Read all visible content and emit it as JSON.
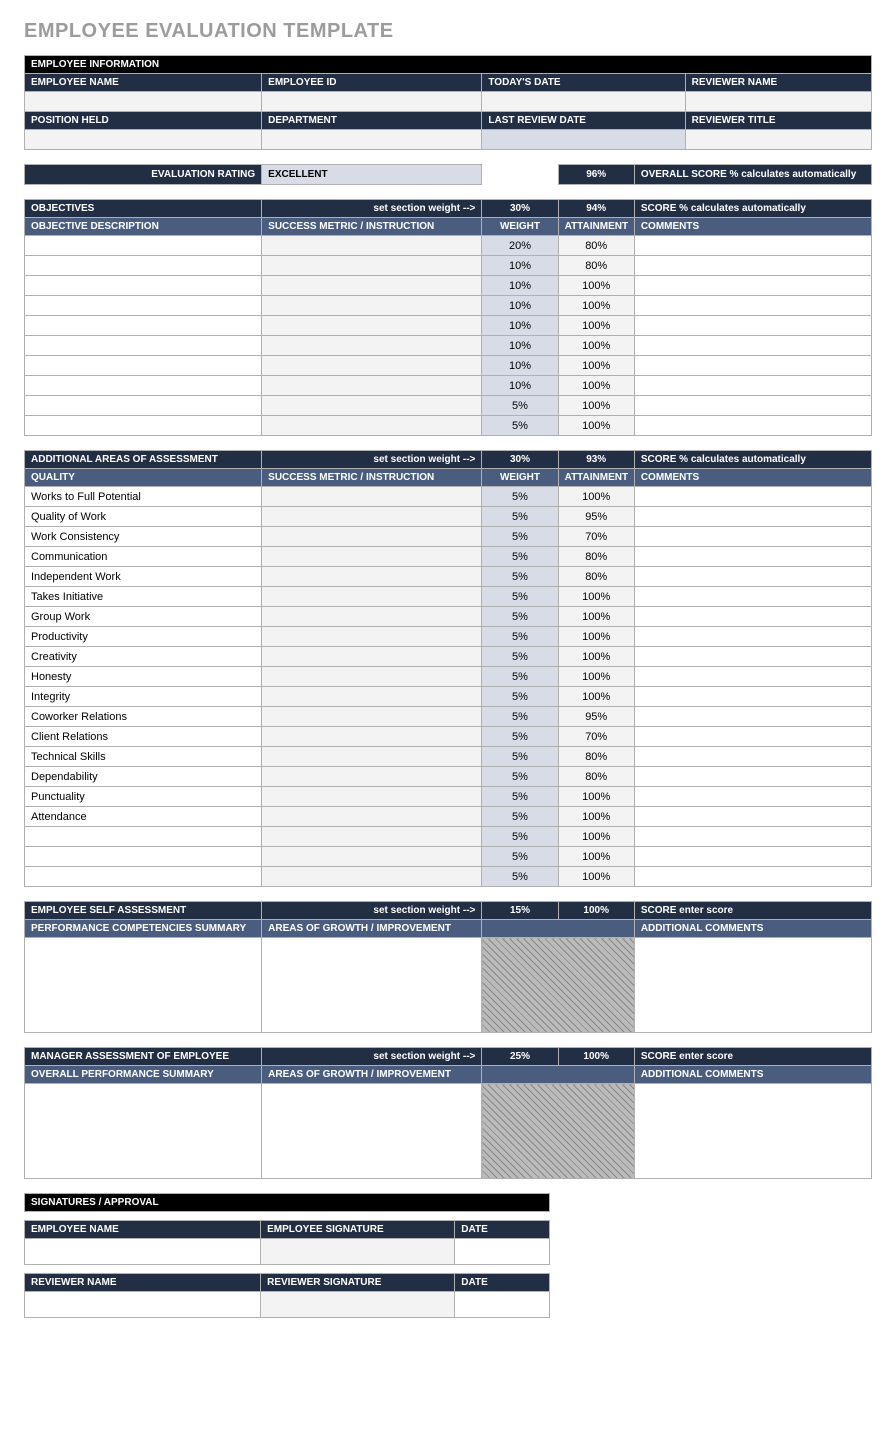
{
  "title": "EMPLOYEE EVALUATION TEMPLATE",
  "info": {
    "header": "EMPLOYEE INFORMATION",
    "labels": {
      "name": "EMPLOYEE NAME",
      "id": "EMPLOYEE ID",
      "date": "TODAY'S DATE",
      "reviewer": "REVIEWER NAME",
      "position": "POSITION HELD",
      "dept": "DEPARTMENT",
      "lastReview": "LAST REVIEW DATE",
      "revTitle": "REVIEWER TITLE"
    }
  },
  "eval": {
    "ratingLabel": "EVALUATION RATING",
    "rating": "EXCELLENT",
    "overallPct": "96%",
    "overallNote": "OVERALL SCORE  % calculates automatically"
  },
  "objectives": {
    "header": "OBJECTIVES",
    "weightHint": "set section weight -->",
    "weightPct": "30%",
    "scorePct": "94%",
    "scoreNote": "SCORE  % calculates automatically",
    "cols": {
      "desc": "OBJECTIVE DESCRIPTION",
      "metric": "SUCCESS METRIC / INSTRUCTION",
      "weight": "WEIGHT",
      "attain": "ATTAINMENT",
      "comments": "COMMENTS"
    },
    "rows": [
      {
        "desc": "",
        "metric": "",
        "weight": "20%",
        "attain": "80%",
        "comments": ""
      },
      {
        "desc": "",
        "metric": "",
        "weight": "10%",
        "attain": "80%",
        "comments": ""
      },
      {
        "desc": "",
        "metric": "",
        "weight": "10%",
        "attain": "100%",
        "comments": ""
      },
      {
        "desc": "",
        "metric": "",
        "weight": "10%",
        "attain": "100%",
        "comments": ""
      },
      {
        "desc": "",
        "metric": "",
        "weight": "10%",
        "attain": "100%",
        "comments": ""
      },
      {
        "desc": "",
        "metric": "",
        "weight": "10%",
        "attain": "100%",
        "comments": ""
      },
      {
        "desc": "",
        "metric": "",
        "weight": "10%",
        "attain": "100%",
        "comments": ""
      },
      {
        "desc": "",
        "metric": "",
        "weight": "10%",
        "attain": "100%",
        "comments": ""
      },
      {
        "desc": "",
        "metric": "",
        "weight": "5%",
        "attain": "100%",
        "comments": ""
      },
      {
        "desc": "",
        "metric": "",
        "weight": "5%",
        "attain": "100%",
        "comments": ""
      }
    ]
  },
  "assessment": {
    "header": "ADDITIONAL AREAS OF ASSESSMENT",
    "weightHint": "set section weight -->",
    "weightPct": "30%",
    "scorePct": "93%",
    "scoreNote": "SCORE  % calculates automatically",
    "cols": {
      "quality": "QUALITY",
      "metric": "SUCCESS METRIC / INSTRUCTION",
      "weight": "WEIGHT",
      "attain": "ATTAINMENT",
      "comments": "COMMENTS"
    },
    "rows": [
      {
        "quality": "Works to Full Potential",
        "metric": "",
        "weight": "5%",
        "attain": "100%",
        "comments": ""
      },
      {
        "quality": "Quality of Work",
        "metric": "",
        "weight": "5%",
        "attain": "95%",
        "comments": ""
      },
      {
        "quality": "Work Consistency",
        "metric": "",
        "weight": "5%",
        "attain": "70%",
        "comments": ""
      },
      {
        "quality": "Communication",
        "metric": "",
        "weight": "5%",
        "attain": "80%",
        "comments": ""
      },
      {
        "quality": "Independent Work",
        "metric": "",
        "weight": "5%",
        "attain": "80%",
        "comments": ""
      },
      {
        "quality": "Takes Initiative",
        "metric": "",
        "weight": "5%",
        "attain": "100%",
        "comments": ""
      },
      {
        "quality": "Group Work",
        "metric": "",
        "weight": "5%",
        "attain": "100%",
        "comments": ""
      },
      {
        "quality": "Productivity",
        "metric": "",
        "weight": "5%",
        "attain": "100%",
        "comments": ""
      },
      {
        "quality": "Creativity",
        "metric": "",
        "weight": "5%",
        "attain": "100%",
        "comments": ""
      },
      {
        "quality": "Honesty",
        "metric": "",
        "weight": "5%",
        "attain": "100%",
        "comments": ""
      },
      {
        "quality": "Integrity",
        "metric": "",
        "weight": "5%",
        "attain": "100%",
        "comments": ""
      },
      {
        "quality": "Coworker Relations",
        "metric": "",
        "weight": "5%",
        "attain": "95%",
        "comments": ""
      },
      {
        "quality": "Client Relations",
        "metric": "",
        "weight": "5%",
        "attain": "70%",
        "comments": ""
      },
      {
        "quality": "Technical Skills",
        "metric": "",
        "weight": "5%",
        "attain": "80%",
        "comments": ""
      },
      {
        "quality": "Dependability",
        "metric": "",
        "weight": "5%",
        "attain": "80%",
        "comments": ""
      },
      {
        "quality": "Punctuality",
        "metric": "",
        "weight": "5%",
        "attain": "100%",
        "comments": ""
      },
      {
        "quality": "Attendance",
        "metric": "",
        "weight": "5%",
        "attain": "100%",
        "comments": ""
      },
      {
        "quality": "",
        "metric": "",
        "weight": "5%",
        "attain": "100%",
        "comments": ""
      },
      {
        "quality": "",
        "metric": "",
        "weight": "5%",
        "attain": "100%",
        "comments": ""
      },
      {
        "quality": "",
        "metric": "",
        "weight": "5%",
        "attain": "100%",
        "comments": ""
      }
    ]
  },
  "self": {
    "header": "EMPLOYEE SELF ASSESSMENT",
    "weightHint": "set section weight -->",
    "weightPct": "15%",
    "scorePct": "100%",
    "scoreNote": "SCORE  enter score",
    "cols": {
      "a": "PERFORMANCE COMPETENCIES SUMMARY",
      "b": "AREAS OF GROWTH / IMPROVEMENT",
      "c": "ADDITIONAL COMMENTS"
    }
  },
  "manager": {
    "header": "MANAGER ASSESSMENT OF EMPLOYEE",
    "weightHint": "set section weight -->",
    "weightPct": "25%",
    "scorePct": "100%",
    "scoreNote": "SCORE  enter score",
    "cols": {
      "a": "OVERALL PERFORMANCE SUMMARY",
      "b": "AREAS OF GROWTH / IMPROVEMENT",
      "c": "ADDITIONAL COMMENTS"
    }
  },
  "sig": {
    "header": "SIGNATURES / APPROVAL",
    "emp": {
      "name": "EMPLOYEE NAME",
      "sig": "EMPLOYEE SIGNATURE",
      "date": "DATE"
    },
    "rev": {
      "name": "REVIEWER NAME",
      "sig": "REVIEWER SIGNATURE",
      "date": "DATE"
    }
  }
}
